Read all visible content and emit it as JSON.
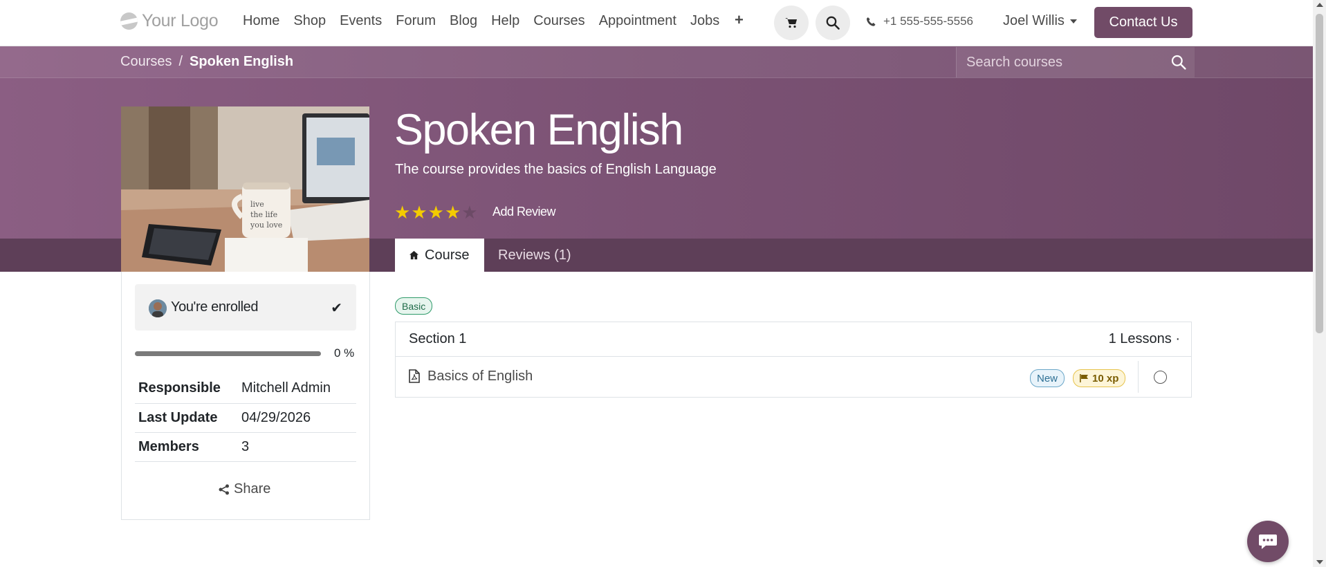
{
  "brand": {
    "logo_text": "Your Logo"
  },
  "nav": {
    "links": [
      "Home",
      "Shop",
      "Events",
      "Forum",
      "Blog",
      "Help",
      "Courses",
      "Appointment",
      "Jobs"
    ],
    "plus": "+",
    "phone": "+1 555-555-5556",
    "user": "Joel Willis",
    "contact": "Contact Us"
  },
  "breadcrumb": {
    "parent": "Courses",
    "separator": "/",
    "current": "Spoken English"
  },
  "search": {
    "placeholder": "Search courses"
  },
  "course": {
    "title": "Spoken English",
    "subtitle": "The course provides the basics of English Language",
    "rating": 4,
    "rating_max": 5,
    "add_review": "Add Review"
  },
  "tabs": {
    "course": "Course",
    "reviews": "Reviews (1)"
  },
  "sidebar": {
    "enrolled": "You're enrolled",
    "progress_percent": 0,
    "progress_label": "0 %",
    "rows": [
      {
        "key": "Responsible",
        "value": "Mitchell Admin"
      },
      {
        "key": "Last Update",
        "value": "04/29/2026"
      },
      {
        "key": "Members",
        "value": "3"
      }
    ],
    "share": "Share"
  },
  "content": {
    "tag": "Basic",
    "section_title": "Section 1",
    "lessons_count": "1 Lessons ·",
    "lesson": {
      "title": "Basics of English",
      "badge_new": "New",
      "badge_xp": "10 xp"
    }
  },
  "colors": {
    "brand": "#714b67",
    "star": "#f3cc00"
  }
}
